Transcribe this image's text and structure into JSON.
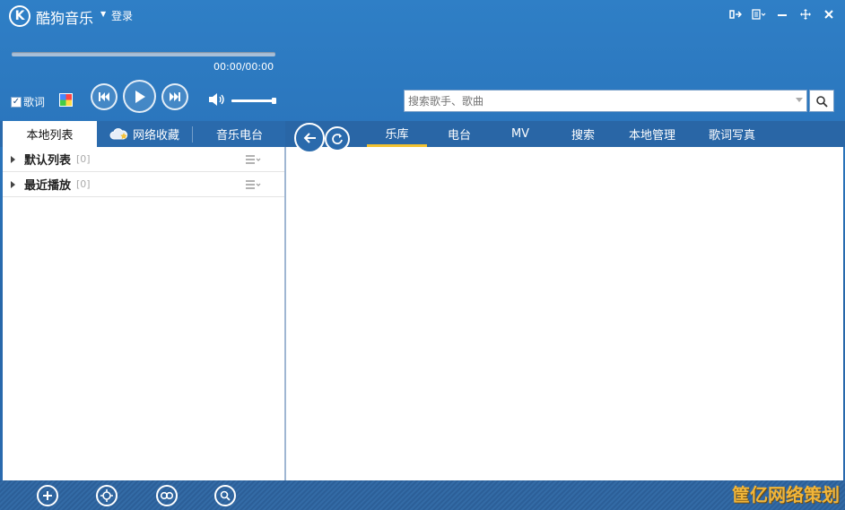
{
  "titlebar": {
    "logo_letter": "K",
    "app_name": "酷狗音乐",
    "login": "登录"
  },
  "player": {
    "time": "00:00/00:00",
    "progress": 0,
    "lyrics_label": "歌词",
    "lyrics_checked": true
  },
  "search": {
    "placeholder": "搜索歌手、歌曲"
  },
  "left_tabs": {
    "local": "本地列表",
    "net": "网络收藏",
    "radio": "音乐电台"
  },
  "playlists": [
    {
      "name": "默认列表",
      "count": "[0]"
    },
    {
      "name": "最近播放",
      "count": "[0]"
    }
  ],
  "nav_tabs": [
    "乐库",
    "电台",
    "MV",
    "搜索",
    "本地管理",
    "歌词写真"
  ],
  "active_nav": "乐库",
  "watermark": "筐亿网络策划",
  "colors": {
    "chrome_blue": "#2a74bb",
    "active_tab_underline": "#f2c230"
  }
}
